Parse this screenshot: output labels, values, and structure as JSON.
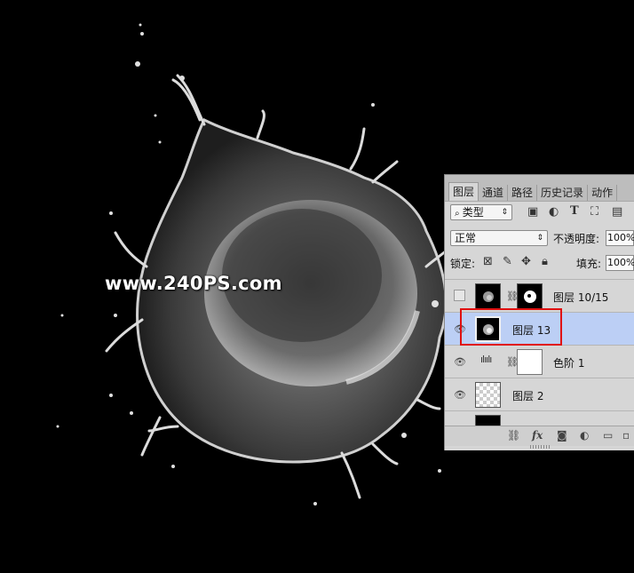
{
  "watermark": "www.240PS.com",
  "panel": {
    "tabs": [
      "图层",
      "通道",
      "路径",
      "历史记录",
      "动作"
    ],
    "active_tab": "图层",
    "filter_select": "类型",
    "filter_icons": [
      "image-icon",
      "adjustment-icon",
      "type-icon",
      "shape-icon",
      "smart-object-icon"
    ],
    "blend_mode": "正常",
    "opacity_label": "不透明度:",
    "opacity_value": "100%",
    "lock_label": "锁定:",
    "fill_label": "填充:",
    "fill_value": "100%",
    "layers": [
      {
        "name": "图层 10/15",
        "visible": false,
        "selected": false,
        "thumb": "splash",
        "mask": "splash-mask"
      },
      {
        "name": "图层 13",
        "visible": true,
        "selected": true,
        "thumb": "splash"
      },
      {
        "name": "色阶 1",
        "visible": true,
        "selected": false,
        "thumb": "levels",
        "mask": "white"
      },
      {
        "name": "图层 2",
        "visible": true,
        "selected": false,
        "thumb": "transparent"
      }
    ],
    "bottom_icons": [
      "link-icon",
      "fx-icon",
      "mask-icon",
      "adjustment-layer-icon",
      "group-folder-icon",
      "new-layer-icon"
    ],
    "colors": {
      "highlight": "#bccff5",
      "annotation": "#e01010"
    }
  }
}
